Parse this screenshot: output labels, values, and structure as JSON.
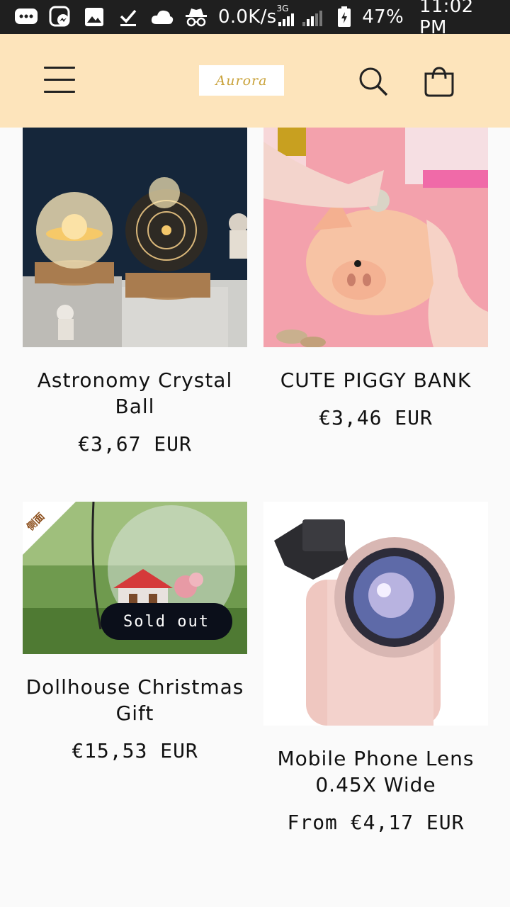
{
  "status_bar": {
    "net_speed": "0.0K/s",
    "network_type": "3G",
    "battery": "47%",
    "time": "11:02 PM"
  },
  "header": {
    "logo_text": "Aurora"
  },
  "products": [
    {
      "title": "Astronomy Crystal Ball",
      "price": "€3,67 EUR"
    },
    {
      "title": "CUTE PIGGY BANK",
      "price": "€3,46 EUR"
    },
    {
      "title": "Dollhouse Christmas Gift",
      "price": "€15,53 EUR",
      "badge": "Sold out",
      "corner_label": "侧面"
    },
    {
      "title": "Mobile Phone Lens 0.45X Wide",
      "price": "From €4,17 EUR"
    }
  ],
  "colors": {
    "header_bg": "#fde4bb",
    "page_bg": "#fafafa",
    "badge_bg": "#0b0f1a",
    "logo_gold": "#c9a23a"
  }
}
